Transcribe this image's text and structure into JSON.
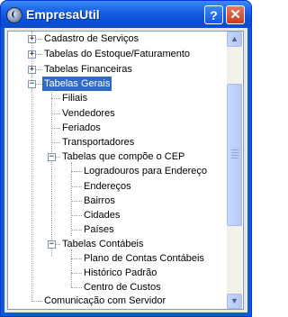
{
  "window": {
    "title": "EmpresaUtil",
    "help_label": "?",
    "close_label": "✕",
    "icon": "app-icon"
  },
  "tree": {
    "items": [
      {
        "label": "Cadastro de Serviços",
        "expander": "+"
      },
      {
        "label": "Tabelas do Estoque/Faturamento",
        "expander": "+"
      },
      {
        "label": "Tabelas Financeiras",
        "expander": "+"
      },
      {
        "label": "Tabelas Gerais",
        "expander": "−",
        "selected": true
      },
      {
        "label": "Filiais"
      },
      {
        "label": "Vendedores"
      },
      {
        "label": "Feriados"
      },
      {
        "label": "Transportadores"
      },
      {
        "label": "Tabelas que compõe o CEP",
        "expander": "−"
      },
      {
        "label": "Logradouros para Endereço"
      },
      {
        "label": "Endereços"
      },
      {
        "label": "Bairros"
      },
      {
        "label": "Cidades"
      },
      {
        "label": "Países"
      },
      {
        "label": "Tabelas Contábeis",
        "expander": "−"
      },
      {
        "label": "Plano de Contas Contábeis"
      },
      {
        "label": "Histórico Padrão"
      },
      {
        "label": "Centro de Custos"
      },
      {
        "label": "Comunicação com Servidor"
      }
    ]
  },
  "scrollbar": {
    "up_arrow": "▲",
    "down_arrow": "▼"
  },
  "colors": {
    "titlebar": "#0a50d8",
    "selection": "#316ac5"
  }
}
